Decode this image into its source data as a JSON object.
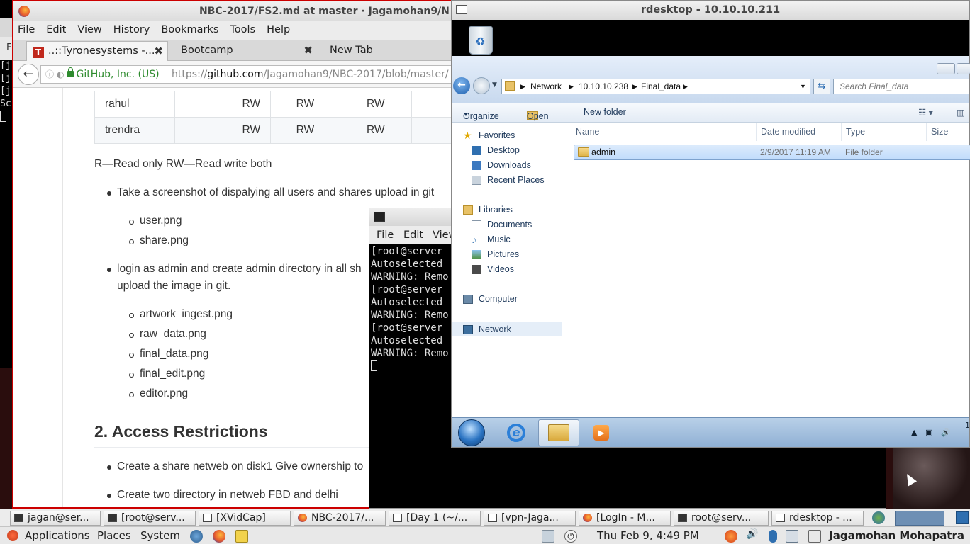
{
  "background_terminal": {
    "lines": [
      "[j",
      "[j",
      "[j",
      "Sc"
    ],
    "tab_letter": "F"
  },
  "firefox": {
    "title": "NBC-2017/FS2.md at master · Jagamohan9/N",
    "menu": [
      "File",
      "Edit",
      "View",
      "History",
      "Bookmarks",
      "Tools",
      "Help"
    ],
    "tabs": [
      {
        "label": "..::Tyronesystems -...",
        "badge": "T"
      },
      {
        "label": "Bootcamp"
      },
      {
        "label": "New Tab"
      }
    ],
    "url": {
      "security": "GitHub, Inc. (US)",
      "prefix": "https://",
      "domain": "github.com",
      "path": "/Jagamohan9/NBC-2017/blob/master/"
    },
    "table": {
      "rows": [
        {
          "name": "rahul",
          "c1": "RW",
          "c2": "RW",
          "c3": "RW"
        },
        {
          "name": "trendra",
          "c1": "RW",
          "c2": "RW",
          "c3": "RW"
        }
      ]
    },
    "legend_text": "R—Read only RW—Read write both",
    "bullets": [
      "Take a screenshot of dispalying all users and shares upload in git",
      "login as admin and create admin directory in all sh",
      "upload the image in git."
    ],
    "sub1": [
      "user.png",
      "share.png"
    ],
    "sub2": [
      "artwork_ingest.png",
      "raw_data.png",
      "final_data.png",
      "final_edit.png",
      "editor.png"
    ],
    "heading": "2. Access Restrictions",
    "bullets2": [
      "Create a share netweb on disk1 Give ownership to",
      "Create two directory in netweb FBD and delhi"
    ]
  },
  "terminal": {
    "menu": [
      "File",
      "Edit",
      "View"
    ],
    "lines": [
      "[root@server",
      "Autoselected",
      "WARNING: Remo",
      "[root@server",
      "Autoselected",
      "WARNING: Remo",
      "[root@server",
      "Autoselected",
      "WARNING: Remo"
    ]
  },
  "rdesktop": {
    "title": "rdesktop - 10.10.10.211",
    "address": [
      "Network",
      "10.10.10.238",
      "Final_data"
    ],
    "search_placeholder": "Search Final_data",
    "commands": [
      "Organize",
      "Open",
      "New folder"
    ],
    "nav": {
      "favorites": "Favorites",
      "fav_items": [
        "Desktop",
        "Downloads",
        "Recent Places"
      ],
      "libraries": "Libraries",
      "lib_items": [
        "Documents",
        "Music",
        "Pictures",
        "Videos"
      ],
      "computer": "Computer",
      "network": "Network"
    },
    "columns": [
      "Name",
      "Date modified",
      "Type",
      "Size"
    ],
    "files": [
      {
        "name": "admin",
        "date": "2/9/2017 11:19 AM",
        "type": "File folder"
      }
    ],
    "tray_digit": "1"
  },
  "bottom_taskbar": {
    "items": [
      "jagan@ser...",
      "[root@serv...",
      "[XVidCap]",
      "NBC-2017/...",
      "[Day 1 (~/...",
      "[vpn-Jaga...",
      "[LogIn - M...",
      "root@serv...",
      "rdesktop - ..."
    ]
  },
  "top_panel": {
    "menus": [
      "Applications",
      "Places",
      "System"
    ],
    "clock": "Thu Feb  9,  4:49 PM",
    "user": "Jagamohan Mohapatra"
  }
}
